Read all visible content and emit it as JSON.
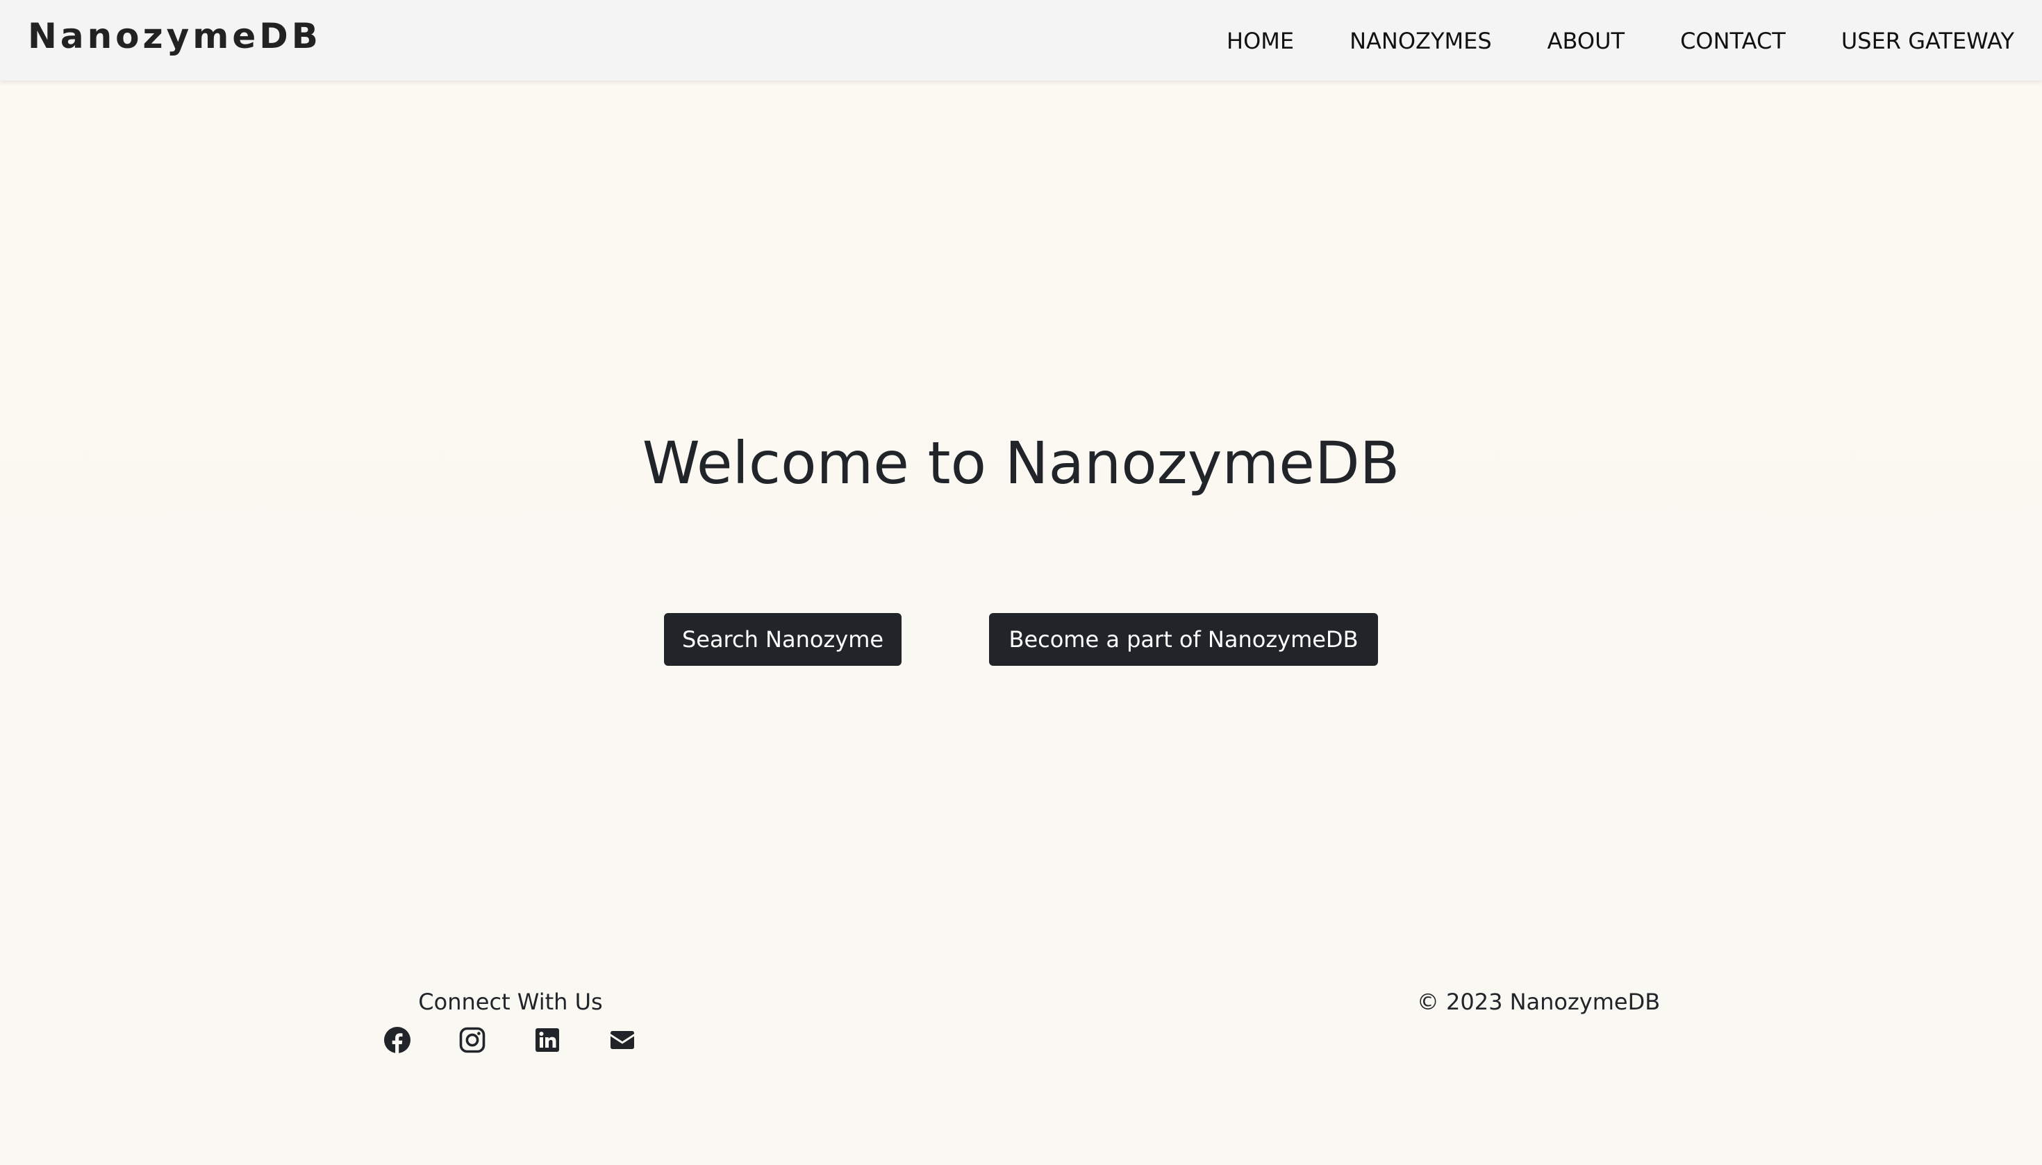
{
  "header": {
    "brand": "NanozymeDB",
    "nav": [
      "HOME",
      "NANOZYMES",
      "ABOUT",
      "CONTACT",
      "USER GATEWAY"
    ]
  },
  "hero": {
    "title": "Welcome to NanozymeDB",
    "search_button": "Search Nanozyme",
    "join_button": "Become a part of NanozymeDB"
  },
  "footer": {
    "connect_label": "Connect With Us",
    "socials": [
      "facebook-icon",
      "instagram-icon",
      "linkedin-icon",
      "envelope-icon"
    ],
    "copyright": "© 2023 NanozymeDB"
  },
  "colors": {
    "background": "#fbf9f3",
    "header_bg": "#f4f4f4",
    "button_bg": "#212529",
    "text": "#212529"
  }
}
